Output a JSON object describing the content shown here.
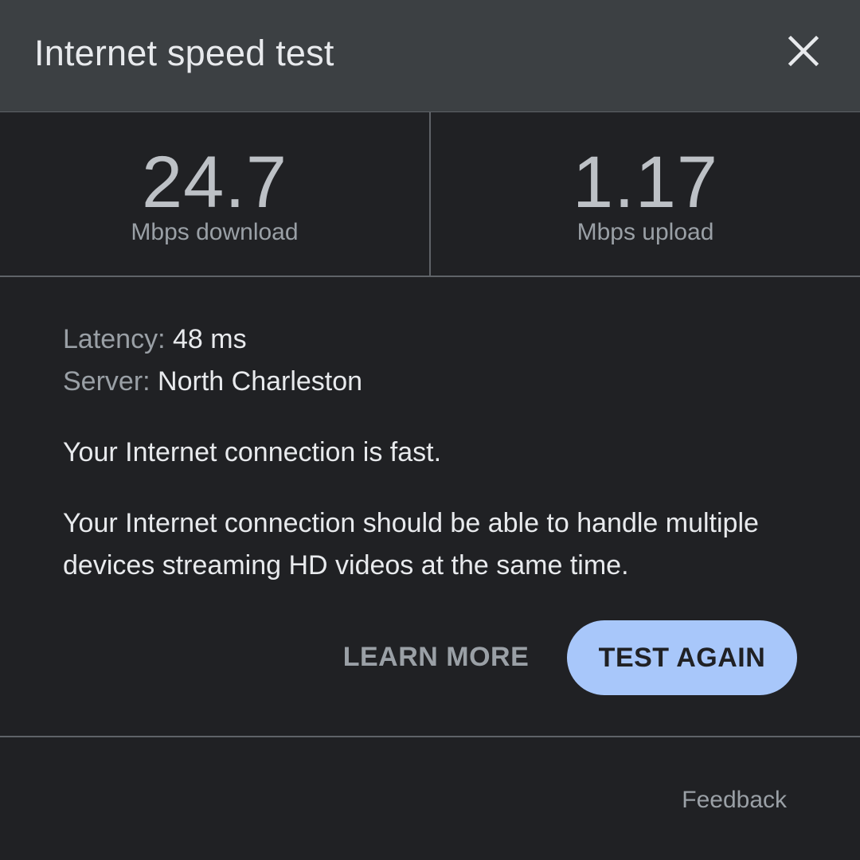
{
  "header": {
    "title": "Internet speed test",
    "close_icon": "close-icon"
  },
  "stats": {
    "download": {
      "value": "24.7",
      "label": "Mbps download"
    },
    "upload": {
      "value": "1.17",
      "label": "Mbps upload"
    }
  },
  "details": {
    "latency_key": "Latency:",
    "latency_value": "48 ms",
    "server_key": "Server:",
    "server_value": "North Charleston"
  },
  "summary": "Your Internet connection is fast.",
  "description": "Your Internet connection should be able to handle multiple devices streaming HD videos at the same time.",
  "actions": {
    "learn_more": "LEARN MORE",
    "test_again": "TEST AGAIN"
  },
  "footer": {
    "feedback": "Feedback"
  },
  "colors": {
    "background": "#202124",
    "header_background": "#3c4043",
    "primary_button": "#a8c7fa",
    "text_primary": "#e8eaed",
    "text_secondary": "#9aa0a6"
  }
}
